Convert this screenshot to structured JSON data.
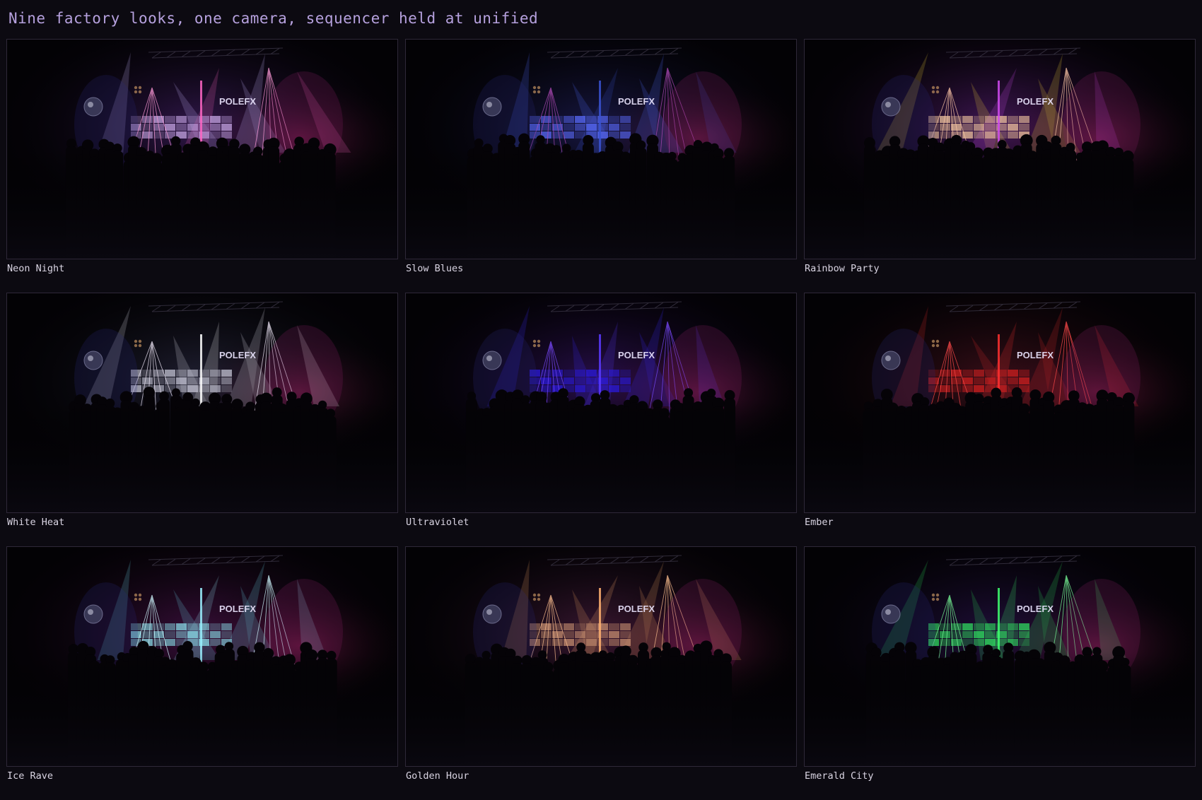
{
  "header": {
    "title": "Nine factory looks, one camera, sequencer held at unified"
  },
  "stage_logo_text": "POLEFX",
  "looks": [
    {
      "name": "Neon Night",
      "colors": {
        "beam": "#c8b8ff",
        "accent": "#ff66c4",
        "panel": "#c9a8e8",
        "wash": "#5a2a8a",
        "laser": "#ff9ad8"
      }
    },
    {
      "name": "Slow Blues",
      "colors": {
        "beam": "#4f6cff",
        "accent": "#3a52d0",
        "panel": "#5b6cff",
        "wash": "#2a2a7a",
        "laser": "#b04ab8"
      }
    },
    {
      "name": "Rainbow Party",
      "colors": {
        "beam": "#f2d43a",
        "accent": "#d04af0",
        "panel": "#f4c8a0",
        "wash": "#7a2aa0",
        "laser": "#ffc8a8"
      }
    },
    {
      "name": "White Heat",
      "colors": {
        "beam": "#e4e4f0",
        "accent": "#ffffff",
        "panel": "#c8c8d8",
        "wash": "#3a3a5a",
        "laser": "#f0e8f8"
      }
    },
    {
      "name": "Ultraviolet",
      "colors": {
        "beam": "#3a2aff",
        "accent": "#5a3aff",
        "panel": "#2a1ae0",
        "wash": "#4a1a8a",
        "laser": "#7a4aff"
      }
    },
    {
      "name": "Ember",
      "colors": {
        "beam": "#e02a2a",
        "accent": "#ff3030",
        "panel": "#d42020",
        "wash": "#6a1a2a",
        "laser": "#ff4a4a"
      }
    },
    {
      "name": "Ice Rave",
      "colors": {
        "beam": "#6ad8e8",
        "accent": "#9af0ff",
        "panel": "#8ae0ea",
        "wash": "#6a1a6a",
        "laser": "#d0f8ff"
      }
    },
    {
      "name": "Golden Hour",
      "colors": {
        "beam": "#e8a060",
        "accent": "#ffb070",
        "panel": "#c89070",
        "wash": "#6a2a5a",
        "laser": "#ffc090"
      }
    },
    {
      "name": "Emerald City",
      "colors": {
        "beam": "#2ae05a",
        "accent": "#40ff70",
        "panel": "#30e060",
        "wash": "#3a1a6a",
        "laser": "#7aff9a"
      }
    }
  ]
}
